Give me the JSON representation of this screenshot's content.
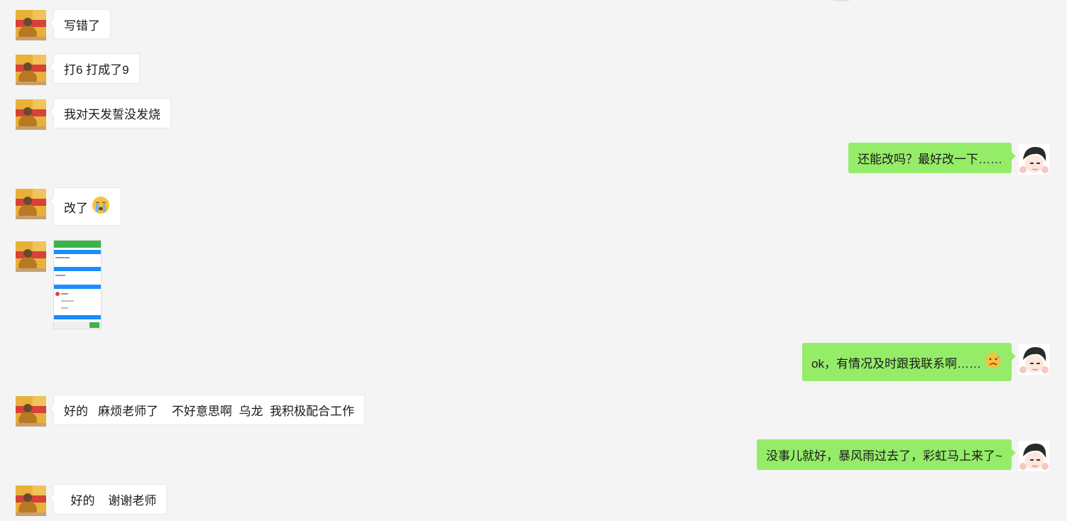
{
  "messages": [
    {
      "side": "left",
      "text": "写错了"
    },
    {
      "side": "left",
      "text": "打6  打成了9"
    },
    {
      "side": "left",
      "text": "我对天发誓没发烧"
    },
    {
      "side": "right",
      "text": "还能改吗？最好改一下……"
    },
    {
      "side": "left",
      "text": "改了",
      "emoji": "crying-face-emoji"
    },
    {
      "side": "left",
      "type": "image",
      "image": "form-screenshot-thumbnail"
    },
    {
      "side": "right",
      "text": "ok，有情况及时跟我联系啊……",
      "emoji": "sad-relieved-face-emoji"
    },
    {
      "side": "left",
      "text": "好的   麻烦老师了    不好意思啊  乌龙  我积极配合工作"
    },
    {
      "side": "right",
      "text": "没事儿就好，暴风雨过去了，彩虹马上来了~"
    },
    {
      "side": "left",
      "text": "  好的    谢谢老师"
    }
  ],
  "colors": {
    "background": "#f4f4f4",
    "self_bubble": "#95ec69",
    "other_bubble": "#ffffff",
    "thumb_accent": "#1a8cff",
    "thumb_header": "#3cb34a"
  },
  "avatars": {
    "other": "woman-portrait-avatar",
    "self": "cartoon-boy-avatar"
  }
}
